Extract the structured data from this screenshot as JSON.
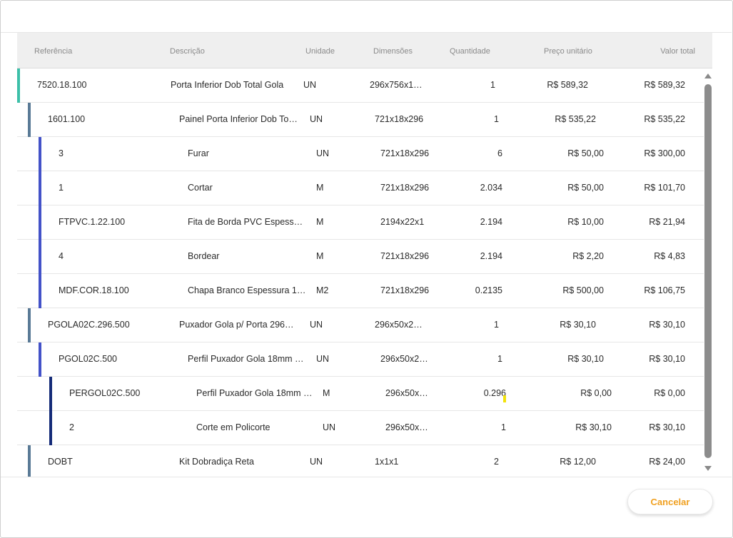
{
  "colors": {
    "accent": "#f0a020",
    "level0": "#3cbfa8",
    "level1": "#5a7a96",
    "level2": "#4352c8",
    "level3": "#142a78"
  },
  "table": {
    "headers": [
      "Referência",
      "Descrição",
      "Unidade",
      "Dimensões",
      "Quantidade",
      "Preço unitário",
      "Valor total"
    ],
    "rows": [
      {
        "level": 0,
        "ref": "7520.18.100",
        "desc": "Porta Inferior Dob Total Gola",
        "unit": "UN",
        "dim": "296x756x1…",
        "qty": "1",
        "price": "R$ 589,32",
        "total": "R$ 589,32"
      },
      {
        "level": 1,
        "ref": "1601.100",
        "desc": "Painel Porta Inferior Dob To…",
        "unit": "UN",
        "dim": "721x18x296",
        "qty": "1",
        "price": "R$ 535,22",
        "total": "R$ 535,22"
      },
      {
        "level": 2,
        "ref": "3",
        "desc": "Furar",
        "unit": "UN",
        "dim": "721x18x296",
        "qty": "6",
        "price": "R$ 50,00",
        "total": "R$ 300,00"
      },
      {
        "level": 2,
        "ref": "1",
        "desc": "Cortar",
        "unit": "M",
        "dim": "721x18x296",
        "qty": "2.034",
        "price": "R$ 50,00",
        "total": "R$ 101,70"
      },
      {
        "level": 2,
        "ref": "FTPVC.1.22.100",
        "desc": "Fita de Borda PVC Espess…",
        "unit": "M",
        "dim": "2194x22x1",
        "qty": "2.194",
        "price": "R$ 10,00",
        "total": "R$ 21,94"
      },
      {
        "level": 2,
        "ref": "4",
        "desc": "Bordear",
        "unit": "M",
        "dim": "721x18x296",
        "qty": "2.194",
        "price": "R$ 2,20",
        "total": "R$ 4,83"
      },
      {
        "level": 2,
        "ref": "MDF.COR.18.100",
        "desc": "Chapa Branco Espessura 1…",
        "unit": "M2",
        "dim": "721x18x296",
        "qty": "0.2135",
        "price": "R$ 500,00",
        "total": "R$ 106,75"
      },
      {
        "level": 1,
        "ref": "PGOLA02C.296.500",
        "desc": "Puxador Gola p/ Porta 296…",
        "unit": "UN",
        "dim": "296x50x2…",
        "qty": "1",
        "price": "R$ 30,10",
        "total": "R$ 30,10"
      },
      {
        "level": 2,
        "ref": "PGOL02C.500",
        "desc": "Perfil Puxador Gola 18mm …",
        "unit": "UN",
        "dim": "296x50x2…",
        "qty": "1",
        "price": "R$ 30,10",
        "total": "R$ 30,10"
      },
      {
        "level": 3,
        "ref": "PERGOL02C.500",
        "desc": "Perfil Puxador Gola 18mm …",
        "unit": "M",
        "dim": "296x50x…",
        "qty": "0.296",
        "price": "R$ 0,00",
        "total": "R$ 0,00"
      },
      {
        "level": 3,
        "ref": "2",
        "desc": "Corte em Policorte",
        "unit": "UN",
        "dim": "296x50x…",
        "qty": "1",
        "price": "R$ 30,10",
        "total": "R$ 30,10"
      },
      {
        "level": 1,
        "ref": "DOBT",
        "desc": "Kit Dobradiça Reta",
        "unit": "UN",
        "dim": "1x1x1",
        "qty": "2",
        "price": "R$ 12,00",
        "total": "R$ 24,00"
      }
    ]
  },
  "footer": {
    "cancel_label": "Cancelar"
  }
}
